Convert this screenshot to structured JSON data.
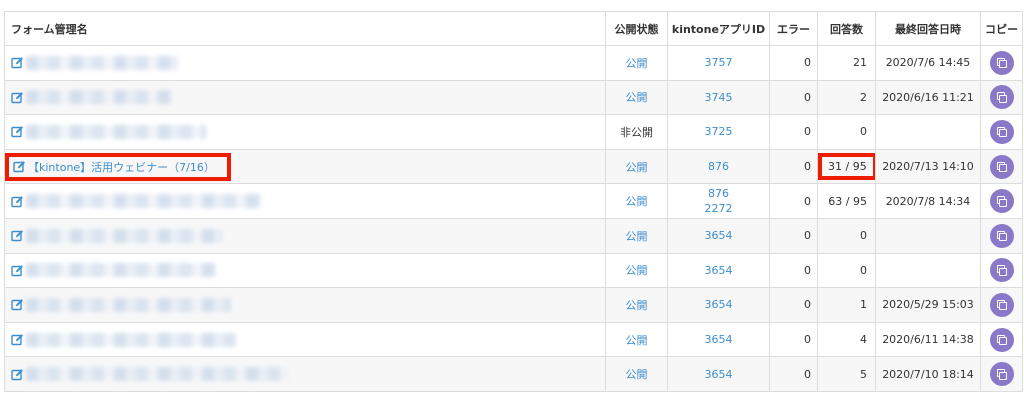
{
  "table": {
    "headers": {
      "name": "フォーム管理名",
      "status": "公開状態",
      "app_id": "kintoneアプリID",
      "error": "エラー",
      "responses": "回答数",
      "last_response": "最終回答日時",
      "copy": "コピー"
    },
    "rows": [
      {
        "name": "",
        "status": "公開",
        "app_ids": [
          "3757"
        ],
        "errors": "0",
        "responses": "21",
        "last_response": "2020/7/6 14:45"
      },
      {
        "name": "",
        "status": "公開",
        "app_ids": [
          "3745"
        ],
        "errors": "0",
        "responses": "2",
        "last_response": "2020/6/16 11:21"
      },
      {
        "name": "",
        "status": "非公開",
        "app_ids": [
          "3725"
        ],
        "errors": "0",
        "responses": "0",
        "last_response": ""
      },
      {
        "name": "【kintone】活用ウェビナー（7/16）",
        "status": "公開",
        "app_ids": [
          "876"
        ],
        "errors": "0",
        "responses": "31 / 95",
        "last_response": "2020/7/13 14:10",
        "highlighted": true
      },
      {
        "name": "",
        "status": "公開",
        "app_ids": [
          "876",
          "2272"
        ],
        "errors": "0",
        "responses": "63 / 95",
        "last_response": "2020/7/8 14:34"
      },
      {
        "name": "",
        "status": "公開",
        "app_ids": [
          "3654"
        ],
        "errors": "0",
        "responses": "0",
        "last_response": ""
      },
      {
        "name": "",
        "status": "公開",
        "app_ids": [
          "3654"
        ],
        "errors": "0",
        "responses": "0",
        "last_response": ""
      },
      {
        "name": "",
        "status": "公開",
        "app_ids": [
          "3654"
        ],
        "errors": "0",
        "responses": "1",
        "last_response": "2020/5/29 15:03"
      },
      {
        "name": "",
        "status": "公開",
        "app_ids": [
          "3654"
        ],
        "errors": "0",
        "responses": "4",
        "last_response": "2020/6/11 14:38"
      },
      {
        "name": "",
        "status": "公開",
        "app_ids": [
          "3654"
        ],
        "errors": "0",
        "responses": "5",
        "last_response": "2020/7/10 18:14"
      }
    ]
  },
  "colors": {
    "link": "#3d8ecf",
    "highlight": "#ee1c00",
    "copy_button": "#8a79c9"
  }
}
